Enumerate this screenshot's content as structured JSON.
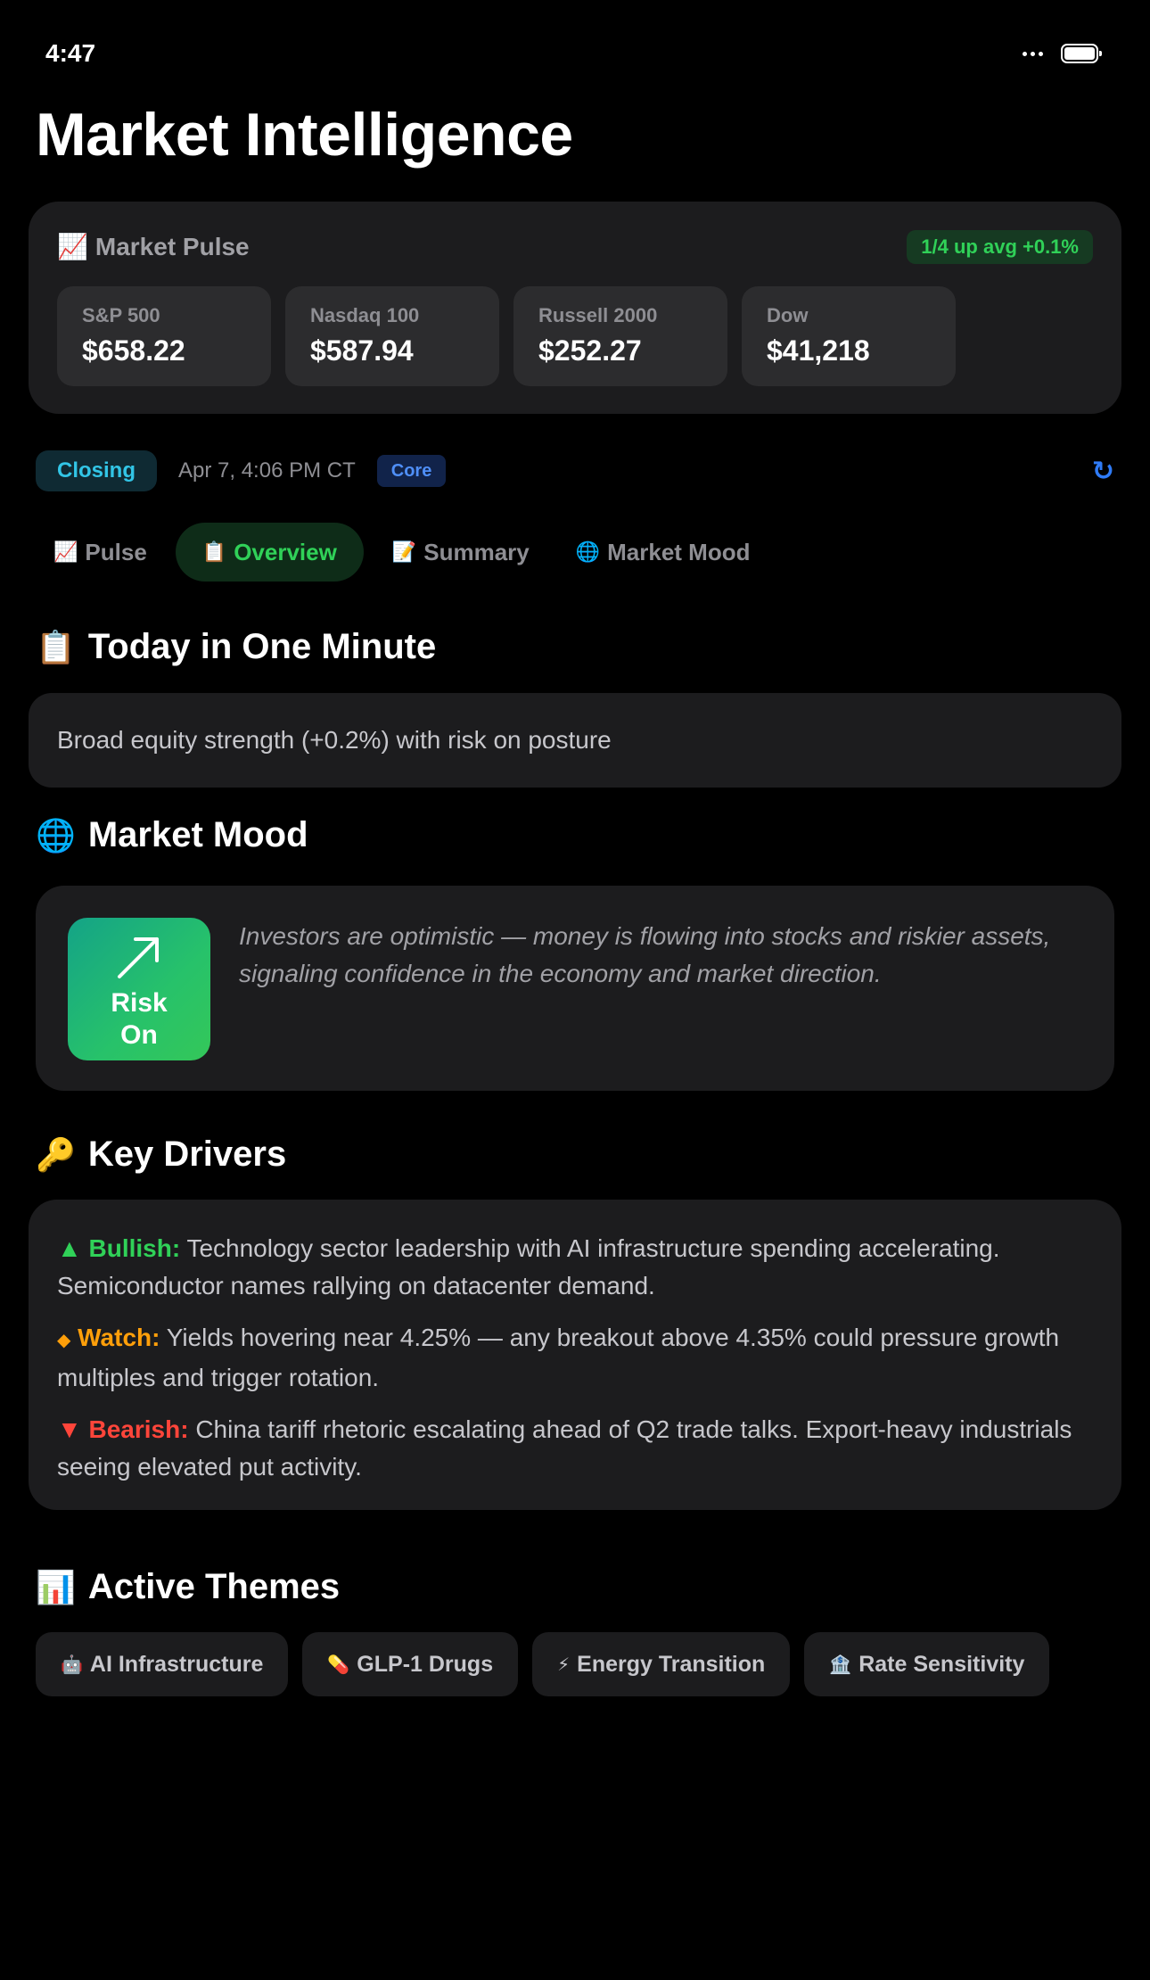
{
  "status_bar": {
    "time": "4:47"
  },
  "page_title": "Market Intelligence",
  "pulse": {
    "icon": "📈",
    "title": "Market Pulse",
    "badge": "1/4 up avg +0.1%",
    "tiles": [
      {
        "label": "S&P 500",
        "value": "$658.22"
      },
      {
        "label": "Nasdaq 100",
        "value": "$587.94"
      },
      {
        "label": "Russell 2000",
        "value": "$252.27"
      },
      {
        "label": "Dow",
        "value": "$41,218"
      }
    ]
  },
  "meta": {
    "session": "Closing",
    "timestamp": "Apr 7, 4:06 PM CT",
    "tier": "Core",
    "refresh_icon": "↻"
  },
  "tabs": [
    {
      "icon": "📈",
      "label": "Pulse",
      "active": false
    },
    {
      "icon": "📋",
      "label": "Overview",
      "active": true
    },
    {
      "icon": "📝",
      "label": "Summary",
      "active": false
    },
    {
      "icon": "🌐",
      "label": "Market Mood",
      "active": false
    }
  ],
  "today": {
    "icon": "📋",
    "title": "Today in One Minute",
    "text": "Broad equity strength (+0.2%) with risk on posture"
  },
  "mood": {
    "icon": "🌐",
    "title": "Market Mood",
    "badge_icon": "arrow-up-right-icon",
    "badge_line1": "Risk",
    "badge_line2": "On",
    "description": "Investors are optimistic — money is flowing into stocks and riskier assets, signaling confidence in the economy and market direction."
  },
  "drivers": {
    "icon": "🔑",
    "title": "Key Drivers",
    "items": [
      {
        "marker": "▲",
        "label": "Bullish:",
        "text": " Technology sector leadership with AI infrastructure spending accelerating. Semiconductor names rallying on datacenter demand."
      },
      {
        "marker": "◆",
        "label": "Watch:",
        "text": " Yields hovering near 4.25% — any breakout above 4.35% could pressure growth multiples and trigger rotation."
      },
      {
        "marker": "▼",
        "label": "Bearish:",
        "text": " China tariff rhetoric escalating ahead of Q2 trade talks. Export-heavy industrials seeing elevated put activity."
      }
    ]
  },
  "themes": {
    "icon": "📊",
    "title": "Active Themes",
    "items": [
      {
        "icon": "🤖",
        "label": "AI Infrastructure"
      },
      {
        "icon": "💊",
        "label": "GLP-1 Drugs"
      },
      {
        "icon": "⚡",
        "label": "Energy Transition"
      },
      {
        "icon": "🏦",
        "label": "Rate Sensitivity"
      }
    ]
  },
  "colors": {
    "bullish": "#30d158",
    "watch": "#ff9f0a",
    "bearish": "#ff453a",
    "accent_blue": "#2f7bf6",
    "closing_cyan": "#32c5e6"
  }
}
